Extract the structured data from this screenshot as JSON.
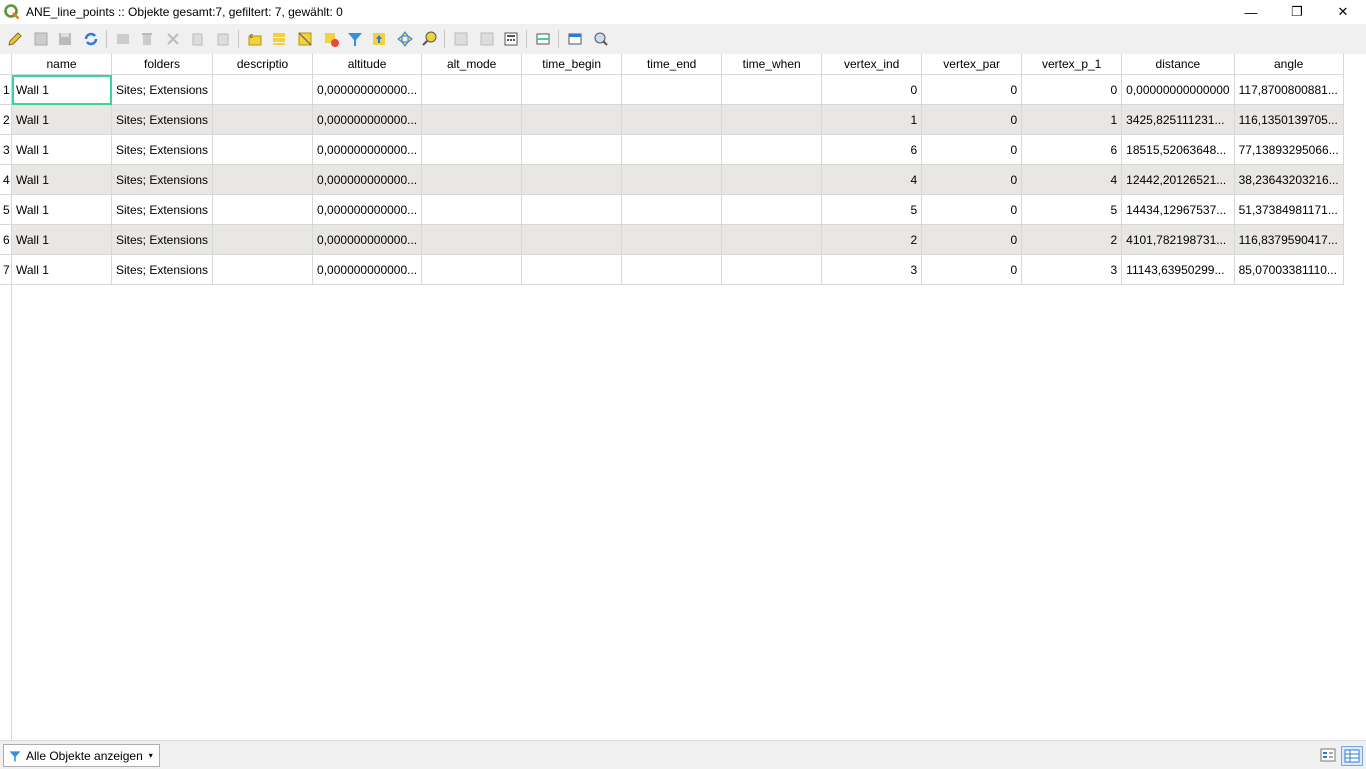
{
  "window": {
    "title": "ANE_line_points :: Objekte gesamt:7, gefiltert: 7, gewählt: 0",
    "minimize": "—",
    "restore": "❐",
    "close": "✕"
  },
  "toolbar": {
    "icons": [
      "pencil-icon",
      "multi-edit-icon",
      "save-icon",
      "reload-icon",
      "add-feature-icon",
      "delete-icon",
      "cut-icon",
      "copy-icon",
      "paste-icon",
      "select-expression-icon",
      "select-all-icon",
      "invert-selection-icon",
      "deselect-icon",
      "filter-icon",
      "move-to-top-icon",
      "pan-to-selection-icon",
      "zoom-to-selection-icon",
      "new-field-icon",
      "delete-field-icon",
      "field-calculator-icon",
      "conditional-format-icon",
      "dock-icon",
      "actions-icon"
    ]
  },
  "table": {
    "columns": [
      "name",
      "folders",
      "descriptio",
      "altitude",
      "alt_mode",
      "time_begin",
      "time_end",
      "time_when",
      "vertex_ind",
      "vertex_par",
      "vertex_p_1",
      "distance",
      "angle"
    ],
    "rows": [
      {
        "rn": "1",
        "name": "Wall 1",
        "folders": "Sites; Extensions",
        "descriptio": "",
        "altitude": "0,000000000000...",
        "alt_mode": "",
        "time_begin": "",
        "time_end": "",
        "time_when": "",
        "vertex_ind": "0",
        "vertex_par": "0",
        "vertex_p_1": "0",
        "distance": "0,00000000000000",
        "angle": "117,8700800881..."
      },
      {
        "rn": "2",
        "name": "Wall 1",
        "folders": "Sites; Extensions",
        "descriptio": "",
        "altitude": "0,000000000000...",
        "alt_mode": "",
        "time_begin": "",
        "time_end": "",
        "time_when": "",
        "vertex_ind": "1",
        "vertex_par": "0",
        "vertex_p_1": "1",
        "distance": "3425,825111231...",
        "angle": "116,1350139705..."
      },
      {
        "rn": "3",
        "name": "Wall 1",
        "folders": "Sites; Extensions",
        "descriptio": "",
        "altitude": "0,000000000000...",
        "alt_mode": "",
        "time_begin": "",
        "time_end": "",
        "time_when": "",
        "vertex_ind": "6",
        "vertex_par": "0",
        "vertex_p_1": "6",
        "distance": "18515,52063648...",
        "angle": "77,13893295066..."
      },
      {
        "rn": "4",
        "name": "Wall 1",
        "folders": "Sites; Extensions",
        "descriptio": "",
        "altitude": "0,000000000000...",
        "alt_mode": "",
        "time_begin": "",
        "time_end": "",
        "time_when": "",
        "vertex_ind": "4",
        "vertex_par": "0",
        "vertex_p_1": "4",
        "distance": "12442,20126521...",
        "angle": "38,23643203216..."
      },
      {
        "rn": "5",
        "name": "Wall 1",
        "folders": "Sites; Extensions",
        "descriptio": "",
        "altitude": "0,000000000000...",
        "alt_mode": "",
        "time_begin": "",
        "time_end": "",
        "time_when": "",
        "vertex_ind": "5",
        "vertex_par": "0",
        "vertex_p_1": "5",
        "distance": "14434,12967537...",
        "angle": "51,37384981171..."
      },
      {
        "rn": "6",
        "name": "Wall 1",
        "folders": "Sites; Extensions",
        "descriptio": "",
        "altitude": "0,000000000000...",
        "alt_mode": "",
        "time_begin": "",
        "time_end": "",
        "time_when": "",
        "vertex_ind": "2",
        "vertex_par": "0",
        "vertex_p_1": "2",
        "distance": "4101,782198731...",
        "angle": "116,8379590417..."
      },
      {
        "rn": "7",
        "name": "Wall 1",
        "folders": "Sites; Extensions",
        "descriptio": "",
        "altitude": "0,000000000000...",
        "alt_mode": "",
        "time_begin": "",
        "time_end": "",
        "time_when": "",
        "vertex_ind": "3",
        "vertex_par": "0",
        "vertex_p_1": "3",
        "distance": "11143,63950299...",
        "angle": "85,07003381110..."
      }
    ]
  },
  "statusbar": {
    "filter_label": "Alle Objekte anzeigen"
  },
  "colors": {
    "selection_outline": "#3ad39a",
    "alt_row": "#e9e7e3",
    "qgis_green": "#589632"
  }
}
